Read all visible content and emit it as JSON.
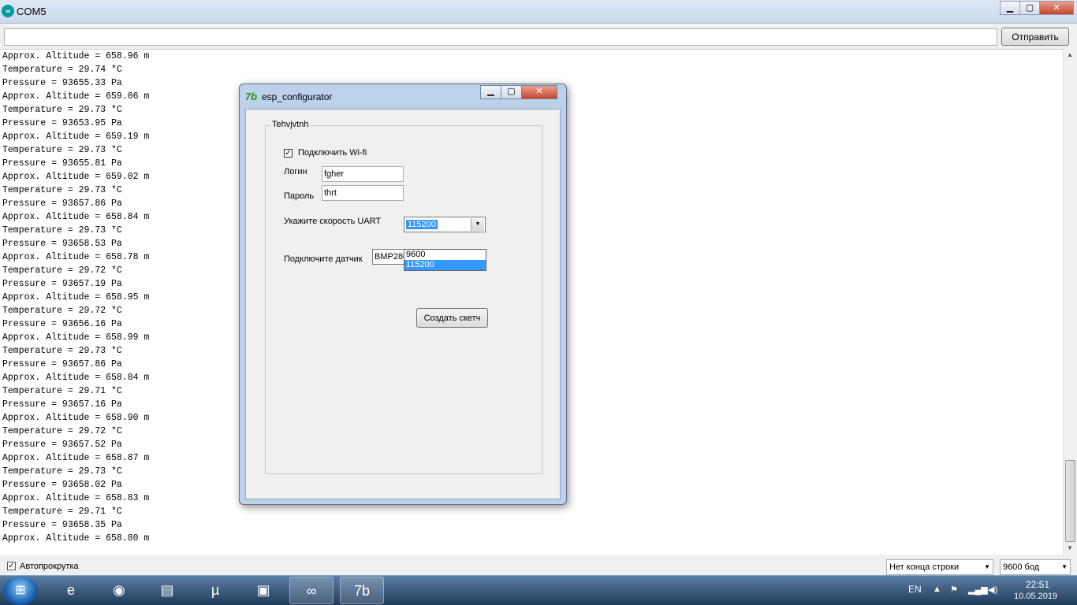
{
  "window": {
    "title": "COM5"
  },
  "send": {
    "button_label": "Отправить",
    "input_value": ""
  },
  "output_lines": [
    "Approx. Altitude = 658.96 m",
    "Temperature = 29.74 *C",
    "Pressure = 93655.33 Pa",
    "Approx. Altitude = 659.06 m",
    "Temperature = 29.73 *C",
    "Pressure = 93653.95 Pa",
    "Approx. Altitude = 659.19 m",
    "Temperature = 29.73 *C",
    "Pressure = 93655.81 Pa",
    "Approx. Altitude = 659.02 m",
    "Temperature = 29.73 *C",
    "Pressure = 93657.86 Pa",
    "Approx. Altitude = 658.84 m",
    "Temperature = 29.73 *C",
    "Pressure = 93658.53 Pa",
    "Approx. Altitude = 658.78 m",
    "Temperature = 29.72 *C",
    "Pressure = 93657.19 Pa",
    "Approx. Altitude = 658.95 m",
    "Temperature = 29.72 *C",
    "Pressure = 93656.16 Pa",
    "Approx. Altitude = 658.99 m",
    "Temperature = 29.73 *C",
    "Pressure = 93657.86 Pa",
    "Approx. Altitude = 658.84 m",
    "Temperature = 29.71 *C",
    "Pressure = 93657.16 Pa",
    "Approx. Altitude = 658.90 m",
    "Temperature = 29.72 *C",
    "Pressure = 93657.52 Pa",
    "Approx. Altitude = 658.87 m",
    "Temperature = 29.73 *C",
    "Pressure = 93658.02 Pa",
    "Approx. Altitude = 658.83 m",
    "Temperature = 29.71 *C",
    "Pressure = 93658.35 Pa",
    "Approx. Altitude = 658.80 m"
  ],
  "bottom": {
    "autoscroll_label": "Автопрокрутка",
    "autoscroll_checked": true,
    "line_ending": "Нет конца строки",
    "baud": "9600 бод"
  },
  "dialog": {
    "title": "esp_configurator",
    "group_label": "Tehvjvtnh",
    "wifi_label": "Подключить Wi-fi",
    "wifi_checked": true,
    "login_label": "Логин",
    "login_value": "fgher",
    "password_label": "Пароль",
    "password_value": "thrt",
    "uart_label": "Укажите скорость UART",
    "uart_value": "115200",
    "uart_options": [
      "9600",
      "115200"
    ],
    "sensor_label": "Подключите датчик",
    "sensor_value": "BMP280",
    "create_button": "Создать скетч"
  },
  "taskbar": {
    "lang": "EN",
    "time": "22:51",
    "date": "10.05.2019"
  },
  "colors": {
    "selection": "#3399ff",
    "taskbar": "#1f3b5a",
    "arduino": "#00979d"
  }
}
